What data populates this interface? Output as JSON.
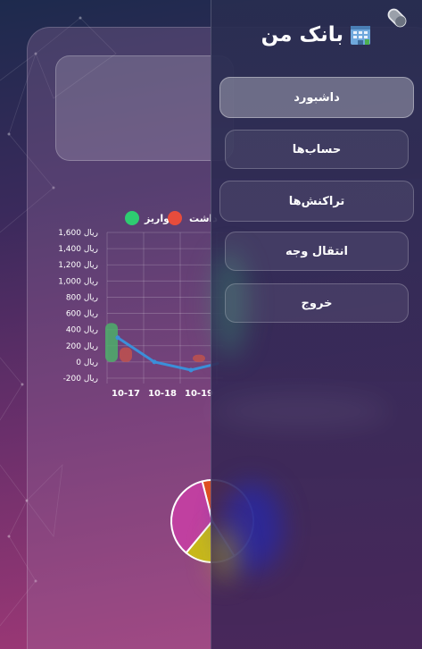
{
  "app": {
    "title": "بانک من",
    "icon": "bank-building-icon",
    "toggle_icon": "pill-toggle-icon"
  },
  "nav": {
    "items": [
      {
        "label": "داشبورد",
        "active": true
      },
      {
        "label": "حساب‌ها",
        "active": false
      },
      {
        "label": "تراکنش‌ها",
        "active": false
      },
      {
        "label": "انتقال وجه",
        "active": false
      },
      {
        "label": "خروج",
        "active": false
      }
    ]
  },
  "chart_data": {
    "type": "bar",
    "legend": [
      {
        "name": "واریز",
        "color": "#2ecc71"
      },
      {
        "name": "برداشت",
        "color": "#e74c3c"
      }
    ],
    "legend_visible_text": [
      "واریز",
      "داشت"
    ],
    "categories": [
      "10-17",
      "10-18",
      "10-19"
    ],
    "series": [
      {
        "name": "واریز",
        "values": [
          480,
          0,
          0
        ],
        "color": "#4caf6a"
      },
      {
        "name": "برداشت",
        "values": [
          180,
          0,
          90
        ],
        "color": "#c0514d"
      }
    ],
    "trend": {
      "values": [
        300,
        0,
        -100
      ],
      "color": "#3b8fd9"
    },
    "ylim": [
      -200,
      1600
    ],
    "yticks": [
      "1,600 ریال",
      "1,400 ریال",
      "1,200 ریال",
      "1,000 ریال",
      "800 ریال",
      "600 ریال",
      "400 ریال",
      "200 ریال",
      "0 ریال",
      "-200 ریال"
    ],
    "grid": true
  },
  "pie": {
    "slices": [
      {
        "value": 45,
        "color": "#e0501f"
      },
      {
        "value": 20,
        "color": "#c8b81a"
      },
      {
        "value": 35,
        "color": "#c040a0"
      }
    ]
  }
}
